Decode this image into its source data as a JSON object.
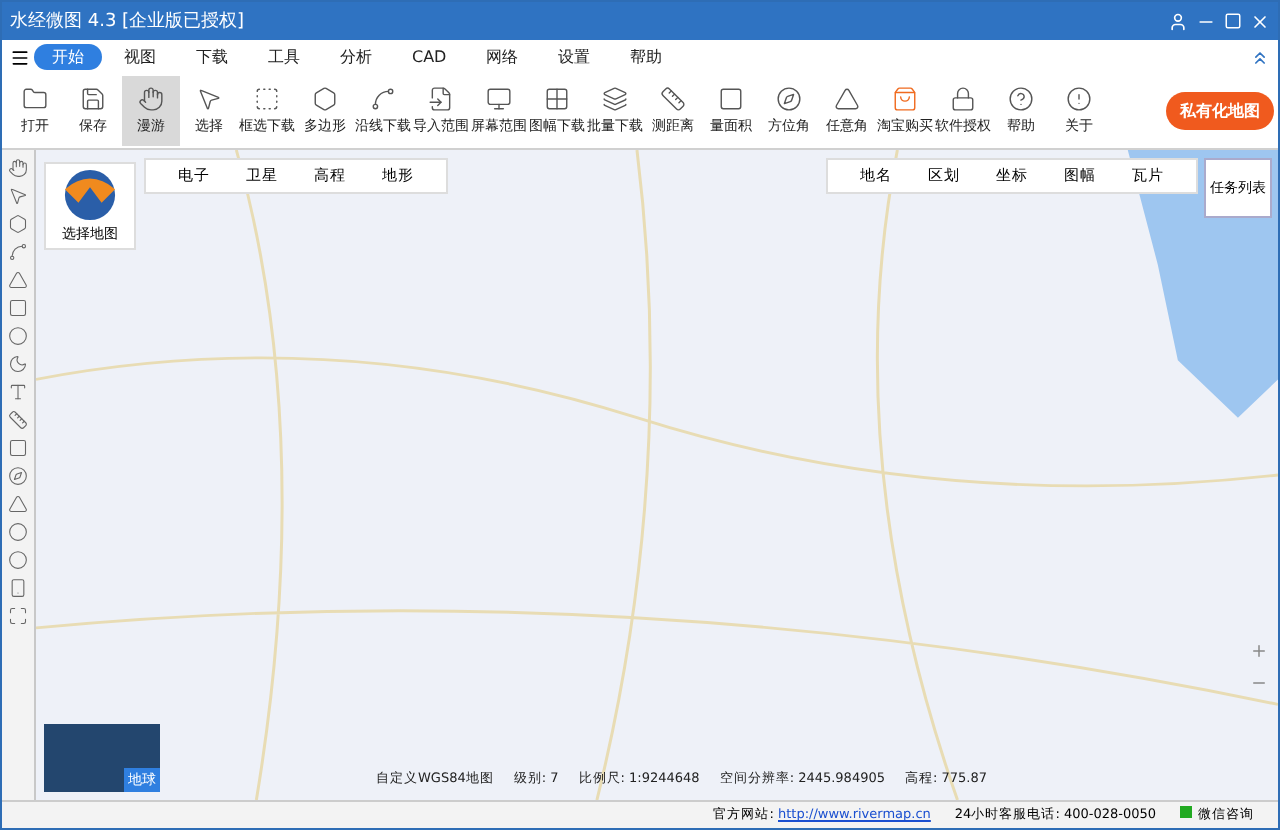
{
  "window": {
    "title": "水经微图 4.3 [企业版已授权]"
  },
  "menu": [
    {
      "label": "开始",
      "selected": true
    },
    {
      "label": "视图",
      "selected": false
    },
    {
      "label": "下载",
      "selected": false
    },
    {
      "label": "工具",
      "selected": false
    },
    {
      "label": "分析",
      "selected": false
    },
    {
      "label": "CAD",
      "selected": false
    },
    {
      "label": "网络",
      "selected": false
    },
    {
      "label": "设置",
      "selected": false
    },
    {
      "label": "帮助",
      "selected": false
    }
  ],
  "toolbar": [
    {
      "label": "打开",
      "selected": false
    },
    {
      "label": "保存",
      "selected": false
    },
    {
      "label": "漫游",
      "selected": true
    },
    {
      "label": "选择",
      "selected": false
    },
    {
      "label": "框选下载",
      "selected": false
    },
    {
      "label": "多边形",
      "selected": false
    },
    {
      "label": "沿线下载",
      "selected": false
    },
    {
      "label": "导入范围",
      "selected": false
    },
    {
      "label": "屏幕范围",
      "selected": false
    },
    {
      "label": "图幅下载",
      "selected": false
    },
    {
      "label": "批量下载",
      "selected": false
    },
    {
      "label": "测距离",
      "selected": false
    },
    {
      "label": "量面积",
      "selected": false
    },
    {
      "label": "方位角",
      "selected": false
    },
    {
      "label": "任意角",
      "selected": false
    },
    {
      "label": "淘宝购买",
      "selected": false
    },
    {
      "label": "软件授权",
      "selected": false
    },
    {
      "label": "帮助",
      "selected": false
    },
    {
      "label": "关于",
      "selected": false
    }
  ],
  "private_map_button": "私有化地图",
  "map": {
    "select_map": "选择地图",
    "map_types": [
      "电子",
      "卫星",
      "高程",
      "地形"
    ],
    "layers": [
      "地名",
      "区划",
      "坐标",
      "图幅",
      "瓦片"
    ],
    "task_list": "任务列表",
    "globe_label": "地球",
    "info": [
      {
        "label": "自定义WGS84地图"
      },
      {
        "label": "级别:",
        "value": "7"
      },
      {
        "label": "比例尺:",
        "value": "1:9244648"
      },
      {
        "label": "空间分辨率:",
        "value": "2445.984905"
      },
      {
        "label": "高程:",
        "value": "775.87"
      }
    ]
  },
  "status_bar": {
    "site_label": "官方网站:",
    "site_link": "http://www.rivermap.cn",
    "phone": "24小时客服电话: 400-028-0050",
    "wechat": "微信咨询"
  }
}
